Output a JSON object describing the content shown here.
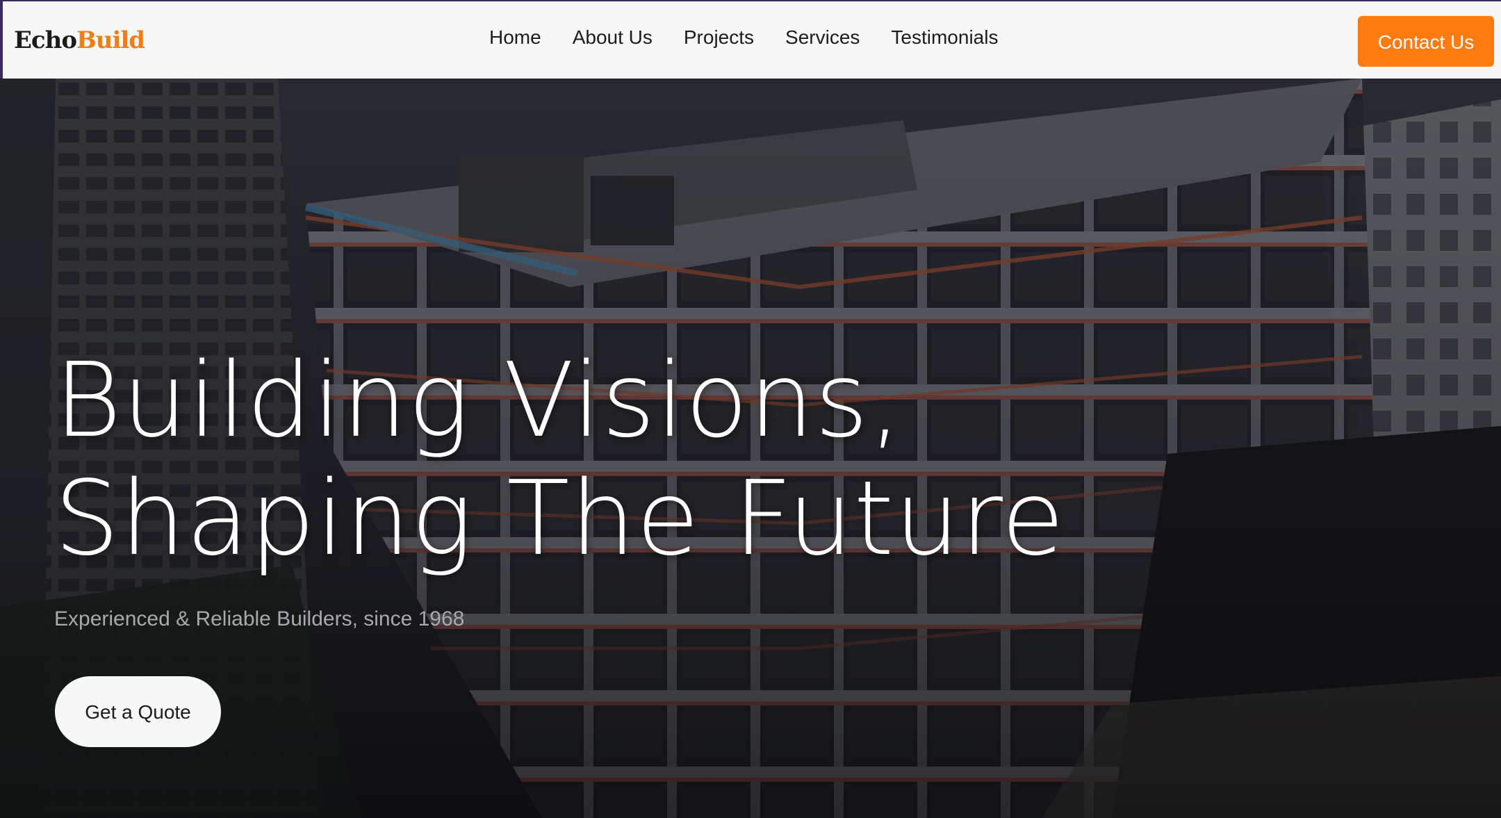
{
  "brand": {
    "logo_part1": "Echo",
    "logo_part2": "Build",
    "accent_color": "#ff7a0f"
  },
  "nav": {
    "items": [
      {
        "label": "Home"
      },
      {
        "label": "About Us"
      },
      {
        "label": "Projects"
      },
      {
        "label": "Services"
      },
      {
        "label": "Testimonials"
      }
    ],
    "contact_label": "Contact Us"
  },
  "hero": {
    "title_line1": "Building Visions,",
    "title_line2": "Shaping The Future",
    "subtitle": "Experienced & Reliable Builders, since 1968",
    "cta_label": "Get a Quote",
    "background": "construction-site-photo"
  }
}
